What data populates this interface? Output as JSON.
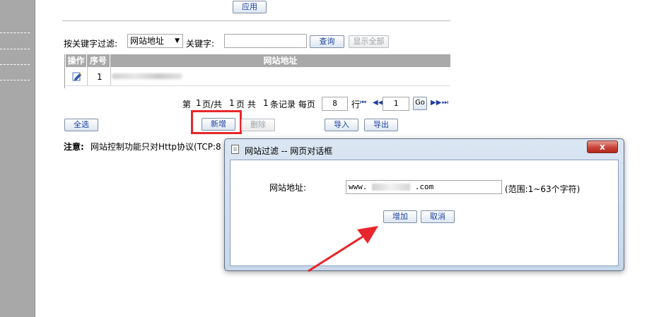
{
  "top": {
    "apply_label": "应用"
  },
  "filter": {
    "by_keyword_label": "按关键字过滤:",
    "field_value": "网站地址",
    "keyword_label": "关键字:",
    "keyword_value": "",
    "query_label": "查询",
    "show_all_label": "显示全部"
  },
  "table": {
    "headers": [
      "操作",
      "序号",
      "网站地址"
    ],
    "rows": [
      {
        "index": "1"
      }
    ]
  },
  "pager": {
    "prefix": "第",
    "current_page": "1",
    "page_of": "页/共",
    "total_pages": "1",
    "pages_total_suffix": "页 共",
    "records": "1",
    "records_suffix": "条记录 每页",
    "per_page": "8",
    "row_label": "行",
    "jump_page": "1",
    "go_label": "Go"
  },
  "actions": {
    "select_all": "全选",
    "add": "新增",
    "delete": "删除",
    "import": "导入",
    "export": "导出"
  },
  "note": {
    "label": "注意:",
    "text": "网站控制功能只对Http协议(TCP:8"
  },
  "dialog": {
    "title": "网站过滤 -- 网页对话框",
    "close": "x",
    "url_label": "网站地址:",
    "url_prefix": "www.",
    "url_suffix": ".com",
    "range_hint": "(范围:1~63个字符)",
    "add_label": "增加",
    "cancel_label": "取消"
  },
  "colors": {
    "highlight": "#e8262b",
    "link_blue": "#1a3fa0"
  }
}
